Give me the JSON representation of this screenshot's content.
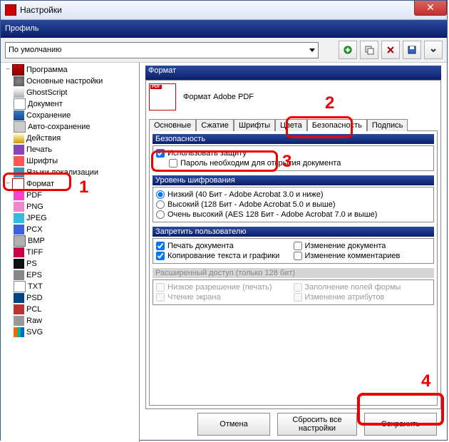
{
  "title": "Настройки",
  "profile_label": "Профиль",
  "profile_combo": "По умолчанию",
  "tree": {
    "root": "Программа",
    "items": [
      "Основные настройки",
      "GhostScript",
      "Документ",
      "Сохранение",
      "Авто-сохранение",
      "Действия",
      "Печать",
      "Шрифты",
      "Языки локализации"
    ],
    "format_node": "Формат",
    "formats": [
      "PDF",
      "PNG",
      "JPEG",
      "PCX",
      "BMP",
      "TIFF",
      "PS",
      "EPS",
      "TXT",
      "PSD",
      "PCL",
      "Raw",
      "SVG"
    ]
  },
  "fmt_title": "Формат",
  "fmt_desc": "Формат Adobe PDF",
  "tabs": [
    "Основные",
    "Сжатие",
    "Шрифты",
    "Цвета",
    "Безопасность",
    "Подпись"
  ],
  "sec": {
    "header": "Безопасность",
    "use": "Использовать защиту",
    "pwd": "Пароль необходим для открытия документа",
    "enc_header": "Уровень шифрования",
    "enc_low": "Низкий (40 Бит - Adobe Acrobat 3.0 и ниже)",
    "enc_high": "Высокий (128 Бит - Adobe Acrobat 5.0 и выше)",
    "enc_vhigh": "Очень высокий (AES 128 Бит - Adobe Acrobat 7.0 и выше)",
    "deny_header": "Запретить пользователю",
    "deny_print": "Печать документа",
    "deny_copy": "Копирование текста и графики",
    "deny_moddoc": "Изменение документа",
    "deny_modcom": "Изменение комментариев",
    "ext_header": "Расширенный доступ (только 128 бит)",
    "ext_lowres": "Низкое разрешение (печать)",
    "ext_screen": "Чтение экрана",
    "ext_form": "Заполнение полей формы",
    "ext_attr": "Изменение атрибутов"
  },
  "buttons": {
    "cancel": "Отмена",
    "reset": "Сбросить все настройки",
    "save": "Сохранить"
  },
  "annotations": {
    "a1": "1",
    "a2": "2",
    "a3": "3",
    "a4": "4"
  }
}
